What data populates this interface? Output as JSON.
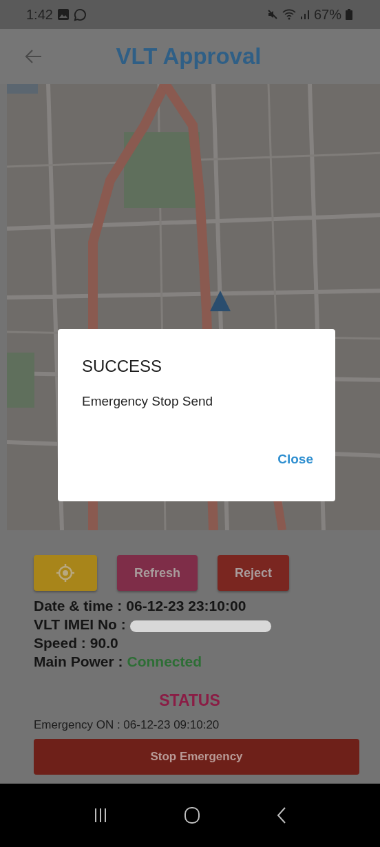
{
  "status_bar": {
    "time": "1:42",
    "battery": "67%"
  },
  "app_bar": {
    "title": "VLT Approval"
  },
  "actions": [
    {
      "kind": "icon",
      "color": "#a8851a"
    },
    {
      "kind": "text",
      "label": "Refresh",
      "color": "#7e2d48"
    },
    {
      "kind": "text",
      "label": "Reject",
      "color": "#7a2620"
    }
  ],
  "details": [
    {
      "label": "Date & time :",
      "value": "06-12-23 23:10:00",
      "kind": "plain"
    },
    {
      "label": "VLT IMEI No :",
      "kind": "redacted"
    },
    {
      "label": "Speed :",
      "value": "90.0",
      "kind": "plain"
    },
    {
      "label": "Main Power :",
      "value": "Connected",
      "kind": "good"
    }
  ],
  "status": {
    "heading": "STATUS",
    "line": "Emergency ON : 06-12-23 09:10:20",
    "button": "Stop Emergency"
  },
  "dialog": {
    "title": "SUCCESS",
    "message": "Emergency Stop Send",
    "action": "Close"
  }
}
